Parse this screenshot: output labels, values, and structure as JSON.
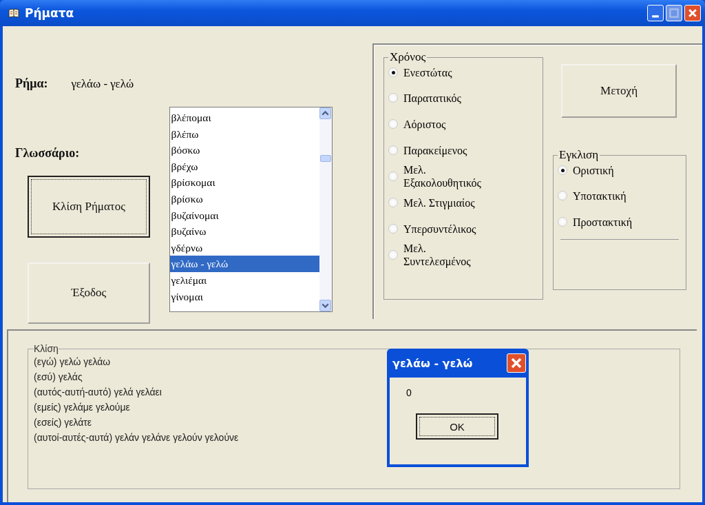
{
  "window": {
    "title": "Ρήματα"
  },
  "verb": {
    "label": "Ρήμα:",
    "value": "γελάω - γελώ"
  },
  "glossary": {
    "label": "Γλωσσάριο:",
    "items": [
      {
        "text": "βλέπομαι",
        "selected": false
      },
      {
        "text": "βλέπω",
        "selected": false
      },
      {
        "text": "βόσκω",
        "selected": false
      },
      {
        "text": "βρέχω",
        "selected": false
      },
      {
        "text": "βρίσκομαι",
        "selected": false
      },
      {
        "text": "βρίσκω",
        "selected": false
      },
      {
        "text": "βυζαίνομαι",
        "selected": false
      },
      {
        "text": "βυζαίνω",
        "selected": false
      },
      {
        "text": "γδέρνω",
        "selected": false
      },
      {
        "text": "γελάω - γελώ",
        "selected": true
      },
      {
        "text": "γελιέμαι",
        "selected": false
      },
      {
        "text": "γίνομαι",
        "selected": false
      }
    ]
  },
  "buttons": [
    {
      "label": "Κλίση Ρήματος",
      "focused": true
    },
    {
      "label": "Έξοδος",
      "focused": false
    }
  ],
  "tense": {
    "title": "Χρόνος",
    "options": [
      {
        "label": "Ενεστώτας",
        "selected": true
      },
      {
        "label": "Παρατατικός",
        "selected": false
      },
      {
        "label": "Αόριστος",
        "selected": false
      },
      {
        "label": "Παρακείμενος",
        "selected": false
      },
      {
        "label": "Μελ. Εξακολουθητικός",
        "selected": false
      },
      {
        "label": "Μελ. Στιγμιαίος",
        "selected": false
      },
      {
        "label": "Υπερσυντέλικος",
        "selected": false
      },
      {
        "label": "Μελ. Συντελεσμένος",
        "selected": false
      }
    ]
  },
  "participle_button": {
    "label": "Μετοχή"
  },
  "mood": {
    "title": "Εγκλιση",
    "options": [
      {
        "label": "Οριστική",
        "selected": true
      },
      {
        "label": "Υποτακτική",
        "selected": false
      },
      {
        "label": "Προστακτική",
        "selected": false
      }
    ]
  },
  "conjugation": {
    "title": "Κλίση",
    "lines": [
      "(εγώ)  γελώ γελάω",
      "(εσύ)  γελάς",
      "(αυτός-αυτή-αυτό)  γελά γελάει",
      "(εμείς)  γελάμε γελούμε",
      "(εσείς)  γελάτε",
      "(αυτοί-αυτές-αυτά)  γελάν γελάνε γελούν γελούνε"
    ]
  },
  "message_box": {
    "title": "γελάω - γελώ",
    "message": "0",
    "button": "OK"
  }
}
